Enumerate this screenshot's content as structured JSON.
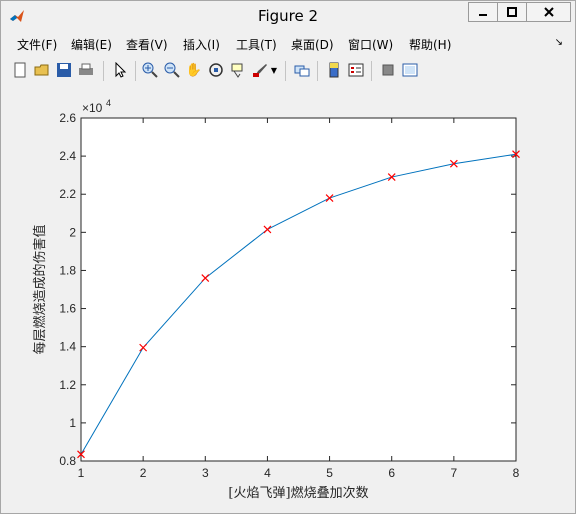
{
  "window": {
    "title": "Figure 2"
  },
  "menu": {
    "items": [
      "文件(F)",
      "编辑(E)",
      "查看(V)",
      "插入(I)",
      "工具(T)",
      "桌面(D)",
      "窗口(W)",
      "帮助(H)"
    ]
  },
  "toolbar": {
    "icons": [
      "new-figure-icon",
      "open-file-icon",
      "save-icon",
      "print-icon",
      "pointer-icon",
      "zoom-in-icon",
      "zoom-out-icon",
      "pan-icon",
      "rotate-3d-icon",
      "data-cursor-icon",
      "brush-icon",
      "brush-dropdown-icon",
      "link-plot-icon",
      "colorbar-icon",
      "legend-icon",
      "hide-plot-tools-icon",
      "show-plot-tools-icon"
    ]
  },
  "chart_data": {
    "type": "line",
    "x": [
      1,
      2,
      3,
      4,
      5,
      6,
      7,
      8
    ],
    "series": [
      {
        "values": [
          8350,
          13950,
          17600,
          20150,
          21800,
          22900,
          23600,
          24100
        ],
        "color": "#0072bd",
        "marker": "x",
        "marker_color": "#ff0000"
      }
    ],
    "xlabel": "[火焰飞弹]燃烧叠加次数",
    "ylabel": "每层燃烧造成的伤害值",
    "xlim": [
      1,
      8
    ],
    "ylim": [
      8000,
      26000
    ],
    "xticks": [
      "1",
      "2",
      "3",
      "4",
      "5",
      "6",
      "7",
      "8"
    ],
    "yticks": [
      "0.8",
      "1",
      "1.2",
      "1.4",
      "1.6",
      "1.8",
      "2",
      "2.2",
      "2.4",
      "2.6"
    ],
    "y_exponent": {
      "base": "×10",
      "power": "4"
    },
    "grid": false
  }
}
